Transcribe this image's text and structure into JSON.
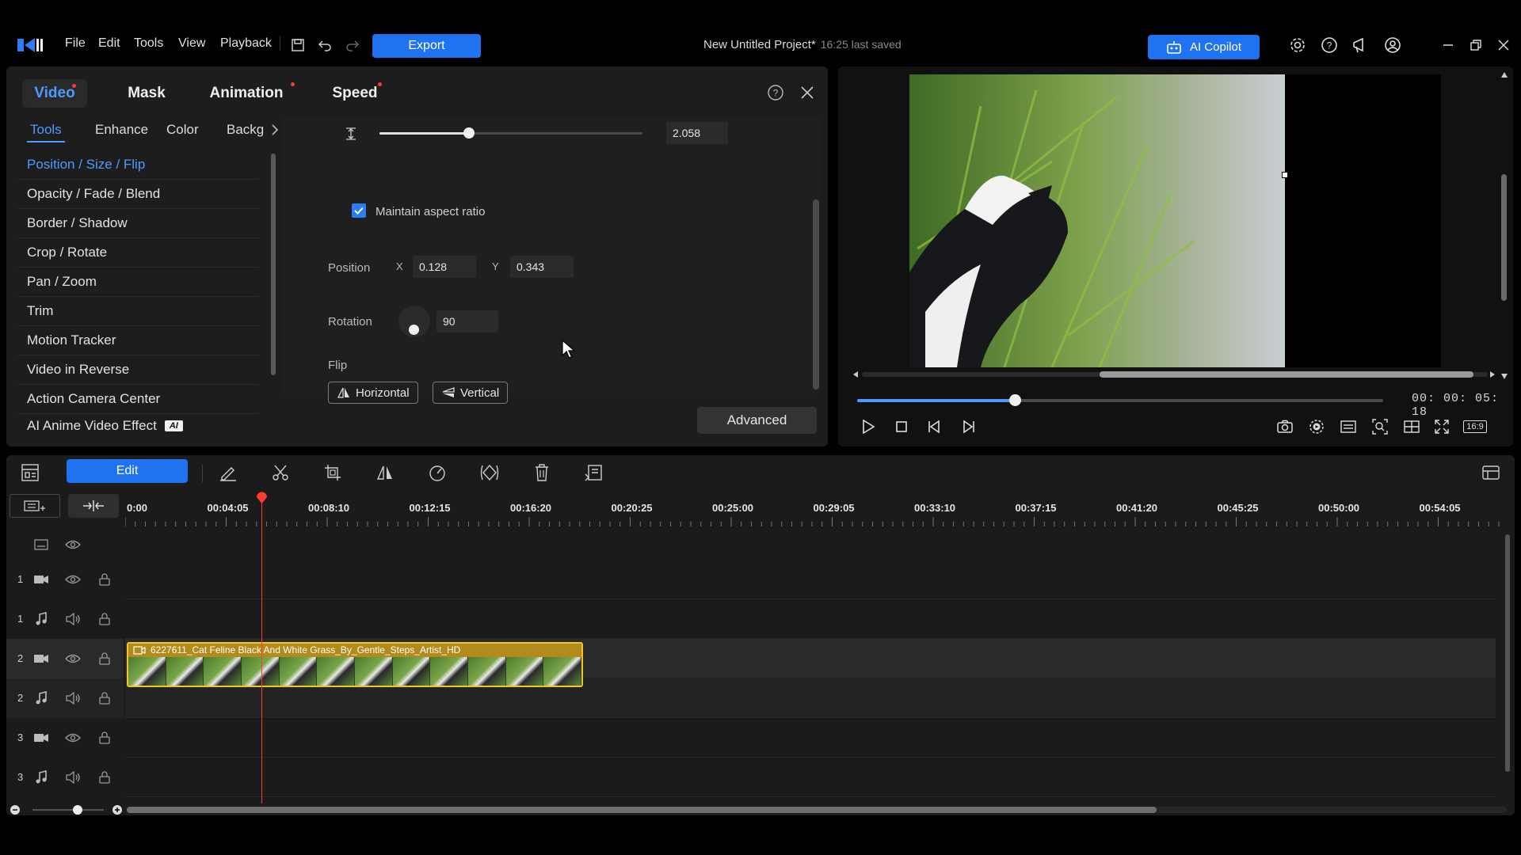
{
  "menu": {
    "file": "File",
    "edit": "Edit",
    "tools": "Tools",
    "view": "View",
    "playback": "Playback"
  },
  "toolbar": {
    "export_label": "Export"
  },
  "project": {
    "title": "New Untitled Project*",
    "saved": "16:25 last saved"
  },
  "ai_copilot": {
    "label": "AI Copilot"
  },
  "props": {
    "tabs": [
      "Video",
      "Mask",
      "Animation",
      "Speed"
    ],
    "subtabs": [
      "Tools",
      "Enhance",
      "Color",
      "Backg"
    ],
    "tools": [
      "Position / Size / Flip",
      "Opacity / Fade / Blend",
      "Border / Shadow",
      "Crop / Rotate",
      "Pan / Zoom",
      "Trim",
      "Motion Tracker",
      "Video in Reverse",
      "Action Camera Center",
      "AI Anime Video Effect"
    ],
    "ai_badge": "AI",
    "scale_value": "2.058",
    "scale_slider_fraction": 0.34,
    "maintain_aspect_label": "Maintain aspect ratio",
    "position_label": "Position",
    "x_label": "X",
    "x_value": "0.128",
    "y_label": "Y",
    "y_value": "0.343",
    "rotation_label": "Rotation",
    "rotation_value": "90",
    "flip_label": "Flip",
    "flip_horizontal": "Horizontal",
    "flip_vertical": "Vertical",
    "advanced_label": "Advanced"
  },
  "preview": {
    "timecode": "00: 00: 05: 18",
    "progress_fraction": 0.3,
    "aspect_label": "16:9"
  },
  "timeline": {
    "edit_label": "Edit",
    "ruler_labels": [
      "0:00",
      "00:04:05",
      "00:08:10",
      "00:12:15",
      "00:16:20",
      "00:20:25",
      "00:25:00",
      "00:29:05",
      "00:33:10",
      "00:37:15",
      "00:41:20",
      "00:45:25",
      "00:50:00",
      "00:54:05"
    ],
    "tracks": [
      {
        "num": "1",
        "kind": "video"
      },
      {
        "num": "1",
        "kind": "audio"
      },
      {
        "num": "2",
        "kind": "video"
      },
      {
        "num": "2",
        "kind": "audio"
      },
      {
        "num": "3",
        "kind": "video"
      },
      {
        "num": "3",
        "kind": "audio"
      }
    ],
    "clip_name": "6227611_Cat Feline Black And White Grass_By_Gentle_Steps_Artist_HD"
  },
  "colors": {
    "accent": "#1f72f0",
    "active_text": "#4d9bff",
    "playhead": "#ff3b30",
    "clip_border": "#f2c230"
  }
}
